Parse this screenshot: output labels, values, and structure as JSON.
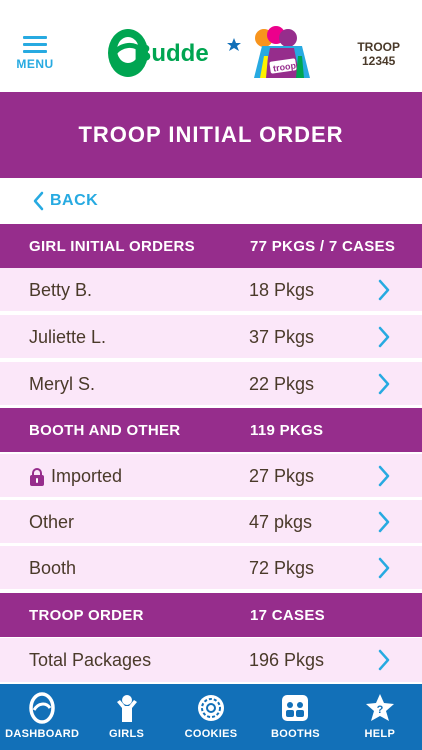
{
  "header": {
    "menu_label": "MENU",
    "logo_text": "Budde",
    "logo_badge": "troop",
    "troop_label": "TROOP",
    "troop_number": "12345"
  },
  "page": {
    "title": "TROOP INITIAL ORDER",
    "back_label": "BACK"
  },
  "sections": {
    "girl_orders": {
      "label": "GIRL INITIAL ORDERS",
      "value": "77 PKGS / 7 CASES",
      "rows": [
        {
          "name": "Betty B.",
          "qty": "18 Pkgs"
        },
        {
          "name": "Juliette L.",
          "qty": "37 Pkgs"
        },
        {
          "name": "Meryl S.",
          "qty": "22 Pkgs"
        }
      ]
    },
    "booth_other": {
      "label": "BOOTH AND OTHER",
      "value": "119 PKGS",
      "rows": [
        {
          "name": "Imported",
          "qty": "27 Pkgs",
          "icon": "lock-icon"
        },
        {
          "name": "Other",
          "qty": "47 pkgs"
        },
        {
          "name": "Booth",
          "qty": "72 Pkgs"
        }
      ]
    },
    "troop_order": {
      "label": "TROOP ORDER",
      "value": "17 CASES",
      "rows": [
        {
          "name": "Total Packages",
          "qty": "196 Pkgs"
        }
      ]
    }
  },
  "bottom_nav": [
    {
      "label": "DASHBOARD",
      "icon": "ebudde-e-icon"
    },
    {
      "label": "GIRLS",
      "icon": "girl-icon"
    },
    {
      "label": "COOKIES",
      "icon": "cookie-icon"
    },
    {
      "label": "BOOTHS",
      "icon": "booth-icon"
    },
    {
      "label": "HELP",
      "icon": "help-star-icon"
    }
  ],
  "colors": {
    "purple": "#962d8c",
    "row_bg": "#fbe7f9",
    "accent_blue": "#27aae1",
    "nav_blue": "#1270b8",
    "text_brown": "#4a3a2a"
  }
}
